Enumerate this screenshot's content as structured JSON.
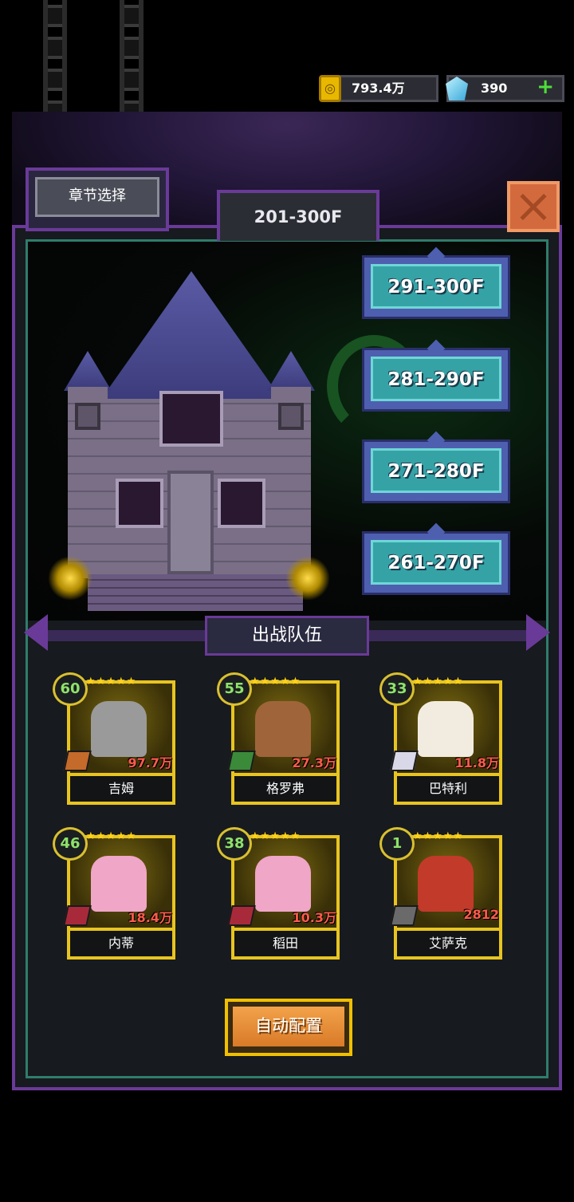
{
  "resources": {
    "gold": {
      "icon": "gold-coin-icon",
      "value": "793.4万"
    },
    "gems": {
      "icon": "diamond-icon",
      "value": "390",
      "add_label": "+"
    }
  },
  "header": {
    "chapter_select_label": "章节选择",
    "current_range": "201-300F",
    "close_icon": "close-icon"
  },
  "floor_buttons": [
    {
      "label": "291-300F"
    },
    {
      "label": "281-290F"
    },
    {
      "label": "271-280F"
    },
    {
      "label": "261-270F"
    }
  ],
  "team": {
    "title": "出战队伍",
    "members": [
      {
        "level": "60",
        "power": "97.7万",
        "name": "吉姆"
      },
      {
        "level": "55",
        "power": "27.3万",
        "name": "格罗弗"
      },
      {
        "level": "33",
        "power": "11.8万",
        "name": "巴特利"
      },
      {
        "level": "46",
        "power": "18.4万",
        "name": "内蒂"
      },
      {
        "level": "38",
        "power": "10.3万",
        "name": "稻田"
      },
      {
        "level": "1",
        "power": "2812",
        "name": "艾萨克"
      }
    ],
    "stars": "★★★★★"
  },
  "auto_config_label": "自动配置",
  "colors": {
    "panel_border": "#6a3a98",
    "floor_button": "#35a3a6",
    "gold_frame": "#e8c420",
    "power_text": "#ff5a4a",
    "level_text": "#8ee26a"
  }
}
